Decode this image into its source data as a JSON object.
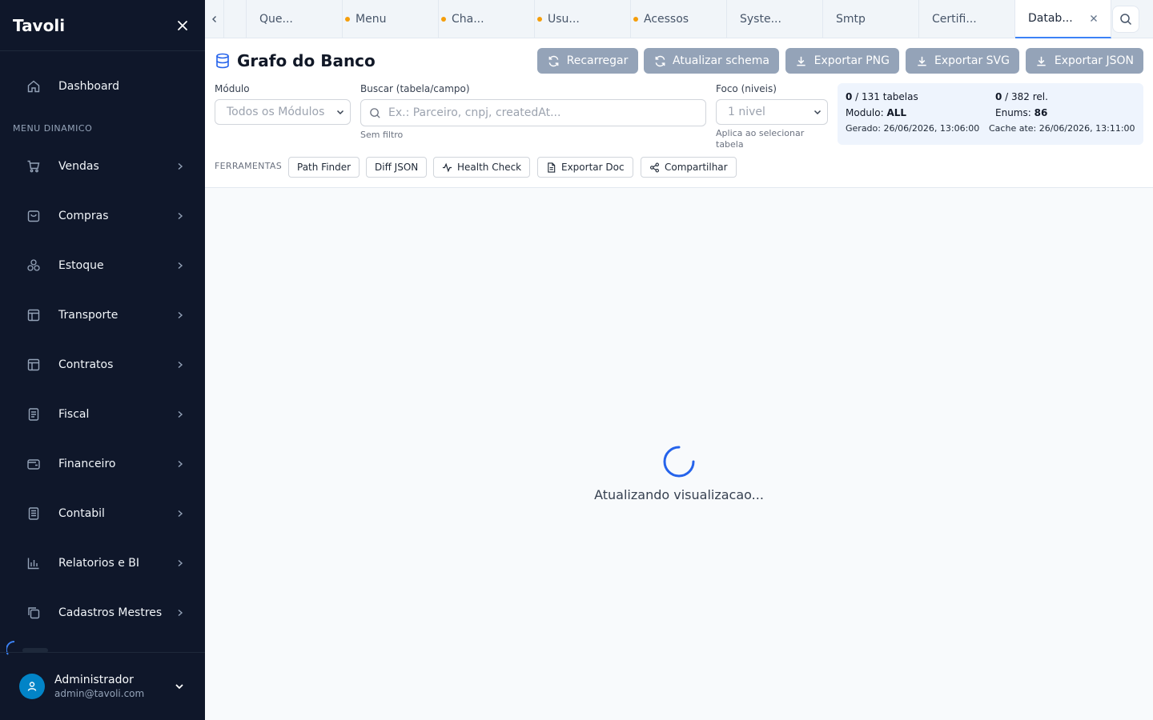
{
  "sidebar": {
    "brand": "Tavoli",
    "section_label": "MENU DINAMICO",
    "items": [
      {
        "label": "Dashboard",
        "icon": "home-icon"
      },
      {
        "label": "Vendas",
        "icon": "cart-icon"
      },
      {
        "label": "Compras",
        "icon": "bag-icon"
      },
      {
        "label": "Estoque",
        "icon": "boxes-icon"
      },
      {
        "label": "Transporte",
        "icon": "layout-icon"
      },
      {
        "label": "Contratos",
        "icon": "layout-icon"
      },
      {
        "label": "Fiscal",
        "icon": "document-icon"
      },
      {
        "label": "Financeiro",
        "icon": "wallet-icon"
      },
      {
        "label": "Contabil",
        "icon": "ledger-icon"
      },
      {
        "label": "Relatorios e BI",
        "icon": "chart-icon"
      },
      {
        "label": "Cadastros Mestres",
        "icon": "copy-icon"
      }
    ],
    "user": {
      "name": "Administrador",
      "email": "admin@tavoli.com"
    }
  },
  "tabs": [
    {
      "label": "Que...",
      "dirty": true
    },
    {
      "label": "Menu",
      "dirty": true
    },
    {
      "label": "Cha...",
      "dirty": true
    },
    {
      "label": "Usu...",
      "dirty": true
    },
    {
      "label": "Acessos",
      "dirty": false
    },
    {
      "label": "Syste...",
      "dirty": false
    },
    {
      "label": "Smtp",
      "dirty": false
    },
    {
      "label": "Certifi...",
      "dirty": false
    },
    {
      "label": "Datab...",
      "dirty": false,
      "active": true
    }
  ],
  "page": {
    "title": "Grafo do Banco",
    "buttons": {
      "reload": "Recarregar",
      "refresh_schema": "Atualizar schema",
      "export_png": "Exportar PNG",
      "export_svg": "Exportar SVG",
      "export_json": "Exportar JSON"
    },
    "filters": {
      "module_label": "Módulo",
      "module_value": "Todos os Módulos",
      "search_label": "Buscar (tabela/campo)",
      "search_placeholder": "Ex.: Parceiro, cnpj, createdAt...",
      "search_hint": "Sem filtro",
      "focus_label": "Foco (niveis)",
      "focus_value": "1 nivel",
      "focus_hint_line1": "Aplica ao selecionar",
      "focus_hint_line2": "tabela"
    },
    "stats": {
      "tables_shown": "0",
      "tables_total": " / 131 tabelas",
      "rels_shown": "0",
      "rels_total": " / 382 rel.",
      "module_label": "Modulo: ",
      "module_value": "ALL",
      "enums_label": "Enums: ",
      "enums_value": "86",
      "generated": "Gerado: 26/06/2026, 13:06:00",
      "cache": "Cache ate: 26/06/2026, 13:11:00"
    },
    "tools_label": "FERRAMENTAS",
    "tools": {
      "path_finder": "Path Finder",
      "diff_json": "Diff JSON",
      "health_check": "Health Check",
      "export_doc": "Exportar Doc",
      "share": "Compartilhar"
    },
    "loading_text": "Atualizando visualizacao..."
  },
  "colors": {
    "sidebar_bg": "#0f172a",
    "accent": "#3b82f6",
    "button_disabled": "#94a3b8",
    "dirty_dot": "#f59e0b"
  }
}
